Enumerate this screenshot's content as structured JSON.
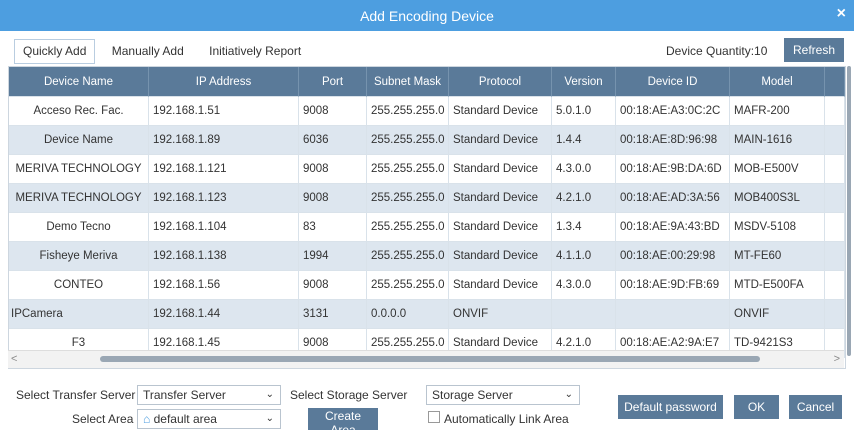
{
  "window": {
    "title": "Add Encoding Device",
    "close_label": "×"
  },
  "tabs": [
    "Quickly Add",
    "Manually Add",
    "Initiatively Report"
  ],
  "device_quantity_label": "Device Quantity:10",
  "refresh_label": "Refresh",
  "table": {
    "columns": [
      "Device Name",
      "IP Address",
      "Port",
      "Subnet Mask",
      "Protocol",
      "Version",
      "Device ID",
      "Model"
    ],
    "rows": [
      [
        "Acceso Rec. Fac.",
        "192.168.1.51",
        "9008",
        "255.255.255.0",
        "Standard Device",
        "5.0.1.0",
        "00:18:AE:A3:0C:2C",
        "MAFR-200"
      ],
      [
        "Device Name",
        "192.168.1.89",
        "6036",
        "255.255.255.0",
        "Standard Device",
        "1.4.4",
        "00:18:AE:8D:96:98",
        "MAIN-1616"
      ],
      [
        "MERIVA TECHNOLOGY",
        "192.168.1.121",
        "9008",
        "255.255.255.0",
        "Standard Device",
        "4.3.0.0",
        "00:18:AE:9B:DA:6D",
        "MOB-E500V"
      ],
      [
        "MERIVA TECHNOLOGY",
        "192.168.1.123",
        "9008",
        "255.255.255.0",
        "Standard Device",
        "4.2.1.0",
        "00:18:AE:AD:3A:56",
        "MOB400S3L"
      ],
      [
        "Demo Tecno",
        "192.168.1.104",
        "83",
        "255.255.255.0",
        "Standard Device",
        "1.3.4",
        "00:18:AE:9A:43:BD",
        "MSDV-5108"
      ],
      [
        "Fisheye Meriva",
        "192.168.1.138",
        "1994",
        "255.255.255.0",
        "Standard Device",
        "4.1.1.0",
        "00:18:AE:00:29:98",
        "MT-FE60"
      ],
      [
        "CONTEO",
        "192.168.1.56",
        "9008",
        "255.255.255.0",
        "Standard Device",
        "4.3.0.0",
        "00:18:AE:9D:FB:69",
        "MTD-E500FA"
      ],
      [
        "IPCamera",
        "192.168.1.44",
        "3131",
        "0.0.0.0",
        "ONVIF",
        "",
        "",
        "ONVIF"
      ],
      [
        "F3",
        "192.168.1.45",
        "9008",
        "255.255.255.0",
        "Standard Device",
        "4.2.1.0",
        "00:18:AE:A2:9A:E7",
        "TD-9421S3"
      ]
    ]
  },
  "footer": {
    "transfer_server_label": "Select Transfer Server",
    "transfer_server_value": "Transfer Server",
    "storage_server_label": "Select Storage Server",
    "storage_server_value": "Storage Server",
    "area_label": "Select Area",
    "area_value": "default area",
    "create_area_label": "Create Area",
    "auto_link_label": "Automatically Link Area",
    "default_password_label": "Default password",
    "ok_label": "OK",
    "cancel_label": "Cancel"
  },
  "colors": {
    "titlebar": "#4d9ee0",
    "header": "#5a7a99",
    "odd_row": "#dde6ef"
  }
}
